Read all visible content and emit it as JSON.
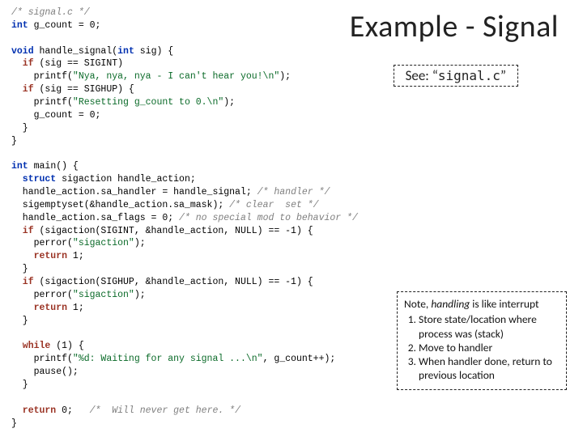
{
  "title": "Example - Signal",
  "see": {
    "prefix": "See: “",
    "file": "signal.c",
    "suffix": "”"
  },
  "note": {
    "lead": "Note, ",
    "ital": "handling",
    "tail": " is like interrupt",
    "items": [
      "Store state/location where process was (stack)",
      "Move to handler",
      "When handler done, return to previous location"
    ]
  },
  "code": {
    "l1_cmt": "/* signal.c */",
    "l2_kw": "int",
    "l2_rest": " g_count ",
    "l2_eq": "=",
    "l2_val": " 0;",
    "l3_kw": "void",
    "l3_rest": " handle_signal(",
    "l3_kw2": "int",
    "l3_rest2": " sig) {",
    "l4_if": "  if",
    "l4_rest": " (sig == SIGINT)",
    "l5_pad": "    printf(",
    "l5_str": "\"Nya, nya, nya - I can't hear you!\\n\"",
    "l5_end": ");",
    "l6_if": "  if",
    "l6_rest": " (sig == SIGHUP) {",
    "l7_pad": "    printf(",
    "l7_str": "\"Resetting g_count to 0.\\n\"",
    "l7_end": ");",
    "l8": "    g_count = 0;",
    "l9": "  }",
    "l10": "}",
    "l11_kw": "int",
    "l11_rest": " main() {",
    "l12_kw": "  struct",
    "l12_rest": " sigaction handle_action;",
    "l13": "  handle_action.sa_handler = handle_signal; ",
    "l13_cmt": "/* handler */",
    "l14": "  sigemptyset(&handle_action.sa_mask); ",
    "l14_cmt": "/* clear  set */",
    "l15": "  handle_action.sa_flags = 0; ",
    "l15_cmt": "/* no special mod to behavior */",
    "l16_if": "  if",
    "l16_rest": " (sigaction(SIGINT, &handle_action, NULL) == -1) {",
    "l17_pad": "    perror(",
    "l17_str": "\"sigaction\"",
    "l17_end": ");",
    "l18_kw": "    return",
    "l18_rest": " 1;",
    "l19": "  }",
    "l20_if": "  if",
    "l20_rest": " (sigaction(SIGHUP, &handle_action, NULL) == -1) {",
    "l21_pad": "    perror(",
    "l21_str": "\"sigaction\"",
    "l21_end": ");",
    "l22_kw": "    return",
    "l22_rest": " 1;",
    "l23": "  }",
    "l24_kw": "  while",
    "l24_rest": " (1) {",
    "l25_pad": "    printf(",
    "l25_str": "\"%d: Waiting for any signal ...\\n\"",
    "l25_end": ", g_count++);",
    "l26": "    pause();",
    "l27": "  }",
    "l28_kw": "  return",
    "l28_rest": " 0;   ",
    "l28_cmt": "/*  Will never get here. */",
    "l29": "}"
  }
}
